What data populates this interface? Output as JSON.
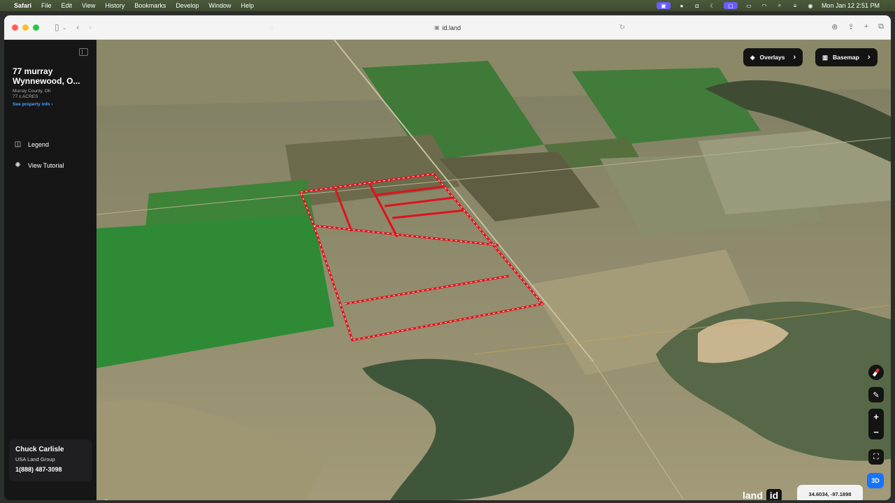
{
  "menubar": {
    "app": "Safari",
    "items": [
      "File",
      "Edit",
      "View",
      "History",
      "Bookmarks",
      "Develop",
      "Window",
      "Help"
    ],
    "clock": "Mon Jan 12  2:51 PM"
  },
  "browser": {
    "url": "id.land"
  },
  "sidebar": {
    "property_title": "77 murray Wynnewood, O...",
    "property_location": "Murray County, OK",
    "property_acres": "77 ± ACRES",
    "property_link": "See property info",
    "nav": [
      {
        "label": "Legend",
        "icon": "layers-icon"
      },
      {
        "label": "View Tutorial",
        "icon": "tutorial-icon"
      }
    ],
    "agent": {
      "name": "Chuck Carlisle",
      "company": "USA Land Group",
      "phone": "1(888) 487-3098"
    }
  },
  "map": {
    "overlays_label": "Overlays",
    "basemap_label": "Basemap",
    "coordinates": "34.6034, -97.1898",
    "brand_left": "land",
    "brand_right": "id",
    "view_mode": "3D",
    "attribution": "mapbox",
    "boundary_color": "#e0121b"
  }
}
